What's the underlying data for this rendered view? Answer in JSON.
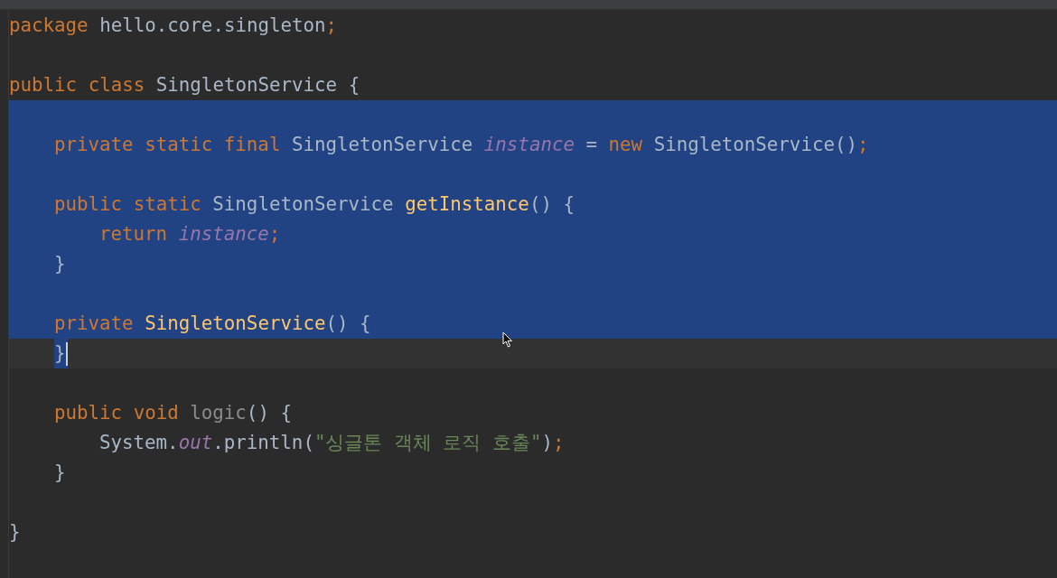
{
  "editor": {
    "lines": [
      {
        "kind": "top",
        "selected": false,
        "current": false,
        "tokens": [
          {
            "kind": "keyword",
            "text": "package "
          },
          {
            "kind": "plain",
            "text": "hello.core.singleton"
          },
          {
            "kind": "keyword",
            "text": ";"
          }
        ]
      },
      {
        "kind": "top",
        "selected": false,
        "current": false
      },
      {
        "kind": "top",
        "selected": false,
        "current": false,
        "tokens": [
          {
            "kind": "keyword",
            "text": "public class "
          },
          {
            "kind": "plain",
            "text": "SingletonService {"
          }
        ]
      },
      {
        "kind": "top",
        "selected": true,
        "current": false
      },
      {
        "kind": "member",
        "selected": true,
        "current": false,
        "tokens": [
          {
            "kind": "keyword",
            "text": "private static final "
          },
          {
            "kind": "plain",
            "text": "SingletonService "
          },
          {
            "kind": "field",
            "text": "instance"
          },
          {
            "kind": "plain",
            "text": " = "
          },
          {
            "kind": "keyword",
            "text": "new "
          },
          {
            "kind": "plain",
            "text": "SingletonService()"
          },
          {
            "kind": "keyword",
            "text": ";"
          }
        ]
      },
      {
        "kind": "top",
        "selected": true,
        "current": false
      },
      {
        "kind": "member",
        "selected": true,
        "current": false,
        "tokens": [
          {
            "kind": "keyword",
            "text": "public static "
          },
          {
            "kind": "plain",
            "text": "SingletonService "
          },
          {
            "kind": "method",
            "text": "getInstance"
          },
          {
            "kind": "plain",
            "text": "() {"
          }
        ]
      },
      {
        "kind": "body",
        "selected": true,
        "current": false,
        "tokens": [
          {
            "kind": "keyword",
            "text": "return "
          },
          {
            "kind": "field",
            "text": "instance"
          },
          {
            "kind": "keyword",
            "text": ";"
          }
        ]
      },
      {
        "kind": "member",
        "selected": true,
        "current": false,
        "tokens": [
          {
            "kind": "plain",
            "text": "}"
          }
        ]
      },
      {
        "kind": "top",
        "selected": true,
        "current": false
      },
      {
        "kind": "member",
        "selected": true,
        "current": false,
        "tokens": [
          {
            "kind": "keyword",
            "text": "private "
          },
          {
            "kind": "method",
            "text": "SingletonService"
          },
          {
            "kind": "plain",
            "text": "() {"
          }
        ]
      },
      {
        "kind": "member",
        "selected": true,
        "current": true,
        "tokens": [
          {
            "kind": "plain",
            "text": "}"
          }
        ]
      },
      {
        "kind": "top",
        "selected": false,
        "current": false
      },
      {
        "kind": "member",
        "selected": false,
        "current": false,
        "tokens": [
          {
            "kind": "keyword",
            "text": "public void "
          },
          {
            "kind": "unused",
            "text": "logic"
          },
          {
            "kind": "plain",
            "text": "() {"
          }
        ]
      },
      {
        "kind": "body",
        "selected": false,
        "current": false,
        "tokens": [
          {
            "kind": "plain",
            "text": "System."
          },
          {
            "kind": "field",
            "text": "out"
          },
          {
            "kind": "plain",
            "text": ".println("
          },
          {
            "kind": "string",
            "text": "\"싱글톤 객체 로직 호출\""
          },
          {
            "kind": "plain",
            "text": ")"
          },
          {
            "kind": "keyword",
            "text": ";"
          }
        ]
      },
      {
        "kind": "member",
        "selected": false,
        "current": false,
        "tokens": [
          {
            "kind": "plain",
            "text": "}"
          }
        ]
      },
      {
        "kind": "top",
        "selected": false,
        "current": false
      },
      {
        "kind": "top",
        "selected": false,
        "current": false,
        "tokens": [
          {
            "kind": "plain",
            "text": "}"
          }
        ]
      }
    ]
  }
}
